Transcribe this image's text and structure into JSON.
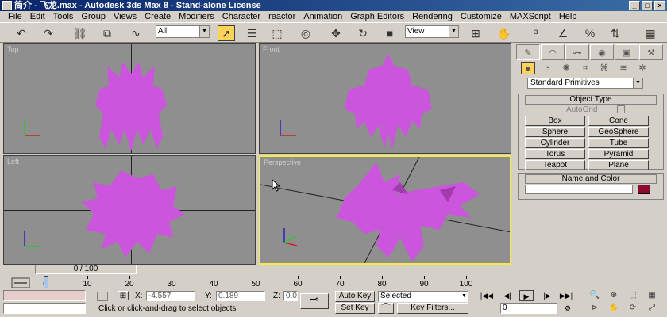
{
  "window": {
    "title": "简介 - 飞龙.max - Autodesk 3ds Max 8  - Stand-alone License"
  },
  "menu": [
    "File",
    "Edit",
    "Tools",
    "Group",
    "Views",
    "Create",
    "Modifiers",
    "Character",
    "reactor",
    "Animation",
    "Graph Editors",
    "Rendering",
    "Customize",
    "MAXScript",
    "Help"
  ],
  "toolbar": {
    "selection_filter": "All",
    "reference_coord": "View"
  },
  "viewports": [
    {
      "name": "top-viewport",
      "label": "Top"
    },
    {
      "name": "front-viewport",
      "label": "Front"
    },
    {
      "name": "left-viewport",
      "label": "Left"
    },
    {
      "name": "perspective-viewport",
      "label": "Perspective"
    }
  ],
  "command_panel": {
    "category": "Standard Primitives",
    "object_type": {
      "header": "Object Type",
      "autogrid": "AutoGrid",
      "buttons": [
        "Box",
        "Cone",
        "Sphere",
        "GeoSphere",
        "Cylinder",
        "Tube",
        "Torus",
        "Pyramid",
        "Teapot",
        "Plane"
      ]
    },
    "name_color": {
      "header": "Name and Color",
      "color": "#8b0a30"
    }
  },
  "timeline": {
    "slider_label": "0 / 100",
    "ticks": [
      "0",
      "10",
      "20",
      "30",
      "40",
      "50",
      "60",
      "70",
      "80",
      "90",
      "100"
    ]
  },
  "status": {
    "prompt": "Click or click-and-drag to select objects",
    "x_label": "X:",
    "x_value": "-4.557",
    "y_label": "Y:",
    "y_value": "0.189",
    "z_label": "Z:",
    "z_value": "0.0",
    "auto_key": "Auto Key",
    "set_key": "Set Key",
    "key_mode": "Selected",
    "key_filters": "Key Filters...",
    "frame": "0"
  },
  "colors": {
    "model": "#cc55dd",
    "viewport_bg": "#8f8f8f",
    "active_border": "#f5e94c"
  }
}
